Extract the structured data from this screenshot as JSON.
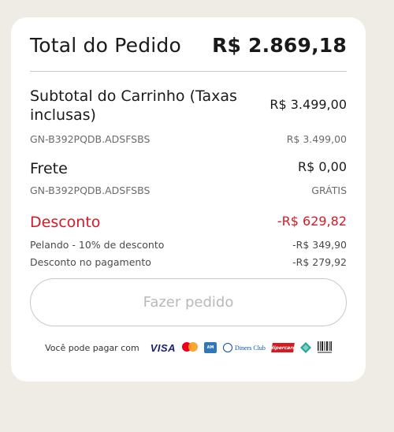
{
  "total": {
    "label": "Total do Pedido",
    "value": "R$ 2.869,18"
  },
  "subtotal": {
    "label": "Subtotal do Carrinho (Taxas inclusas)",
    "value": "R$ 3.499,00",
    "sku": "GN-B392PQDB.ADSFSBS",
    "sku_value": "R$ 3.499,00"
  },
  "shipping": {
    "label": "Frete",
    "value": "R$ 0,00",
    "sku": "GN-B392PQDB.ADSFSBS",
    "sku_value": "GRÁTIS"
  },
  "discount": {
    "label": "Desconto",
    "value": "-R$ 629,82",
    "color": "#d31a26",
    "items": [
      {
        "label": "Pelando - 10% de desconto",
        "value": "-R$ 349,90"
      },
      {
        "label": "Desconto no pagamento",
        "value": "-R$ 279,92"
      }
    ]
  },
  "order_button": {
    "label": "Fazer pedido",
    "enabled": false
  },
  "payment": {
    "label": "Você pode pagar com",
    "methods": [
      "visa-logo",
      "mastercard-logo",
      "amex-logo",
      "diners-club-logo",
      "hipercard-logo",
      "elo-logo",
      "boleto-logo"
    ],
    "visa_text": "VISA",
    "diners_text": "Diners Club",
    "hipercard_text": "Hipercard"
  }
}
